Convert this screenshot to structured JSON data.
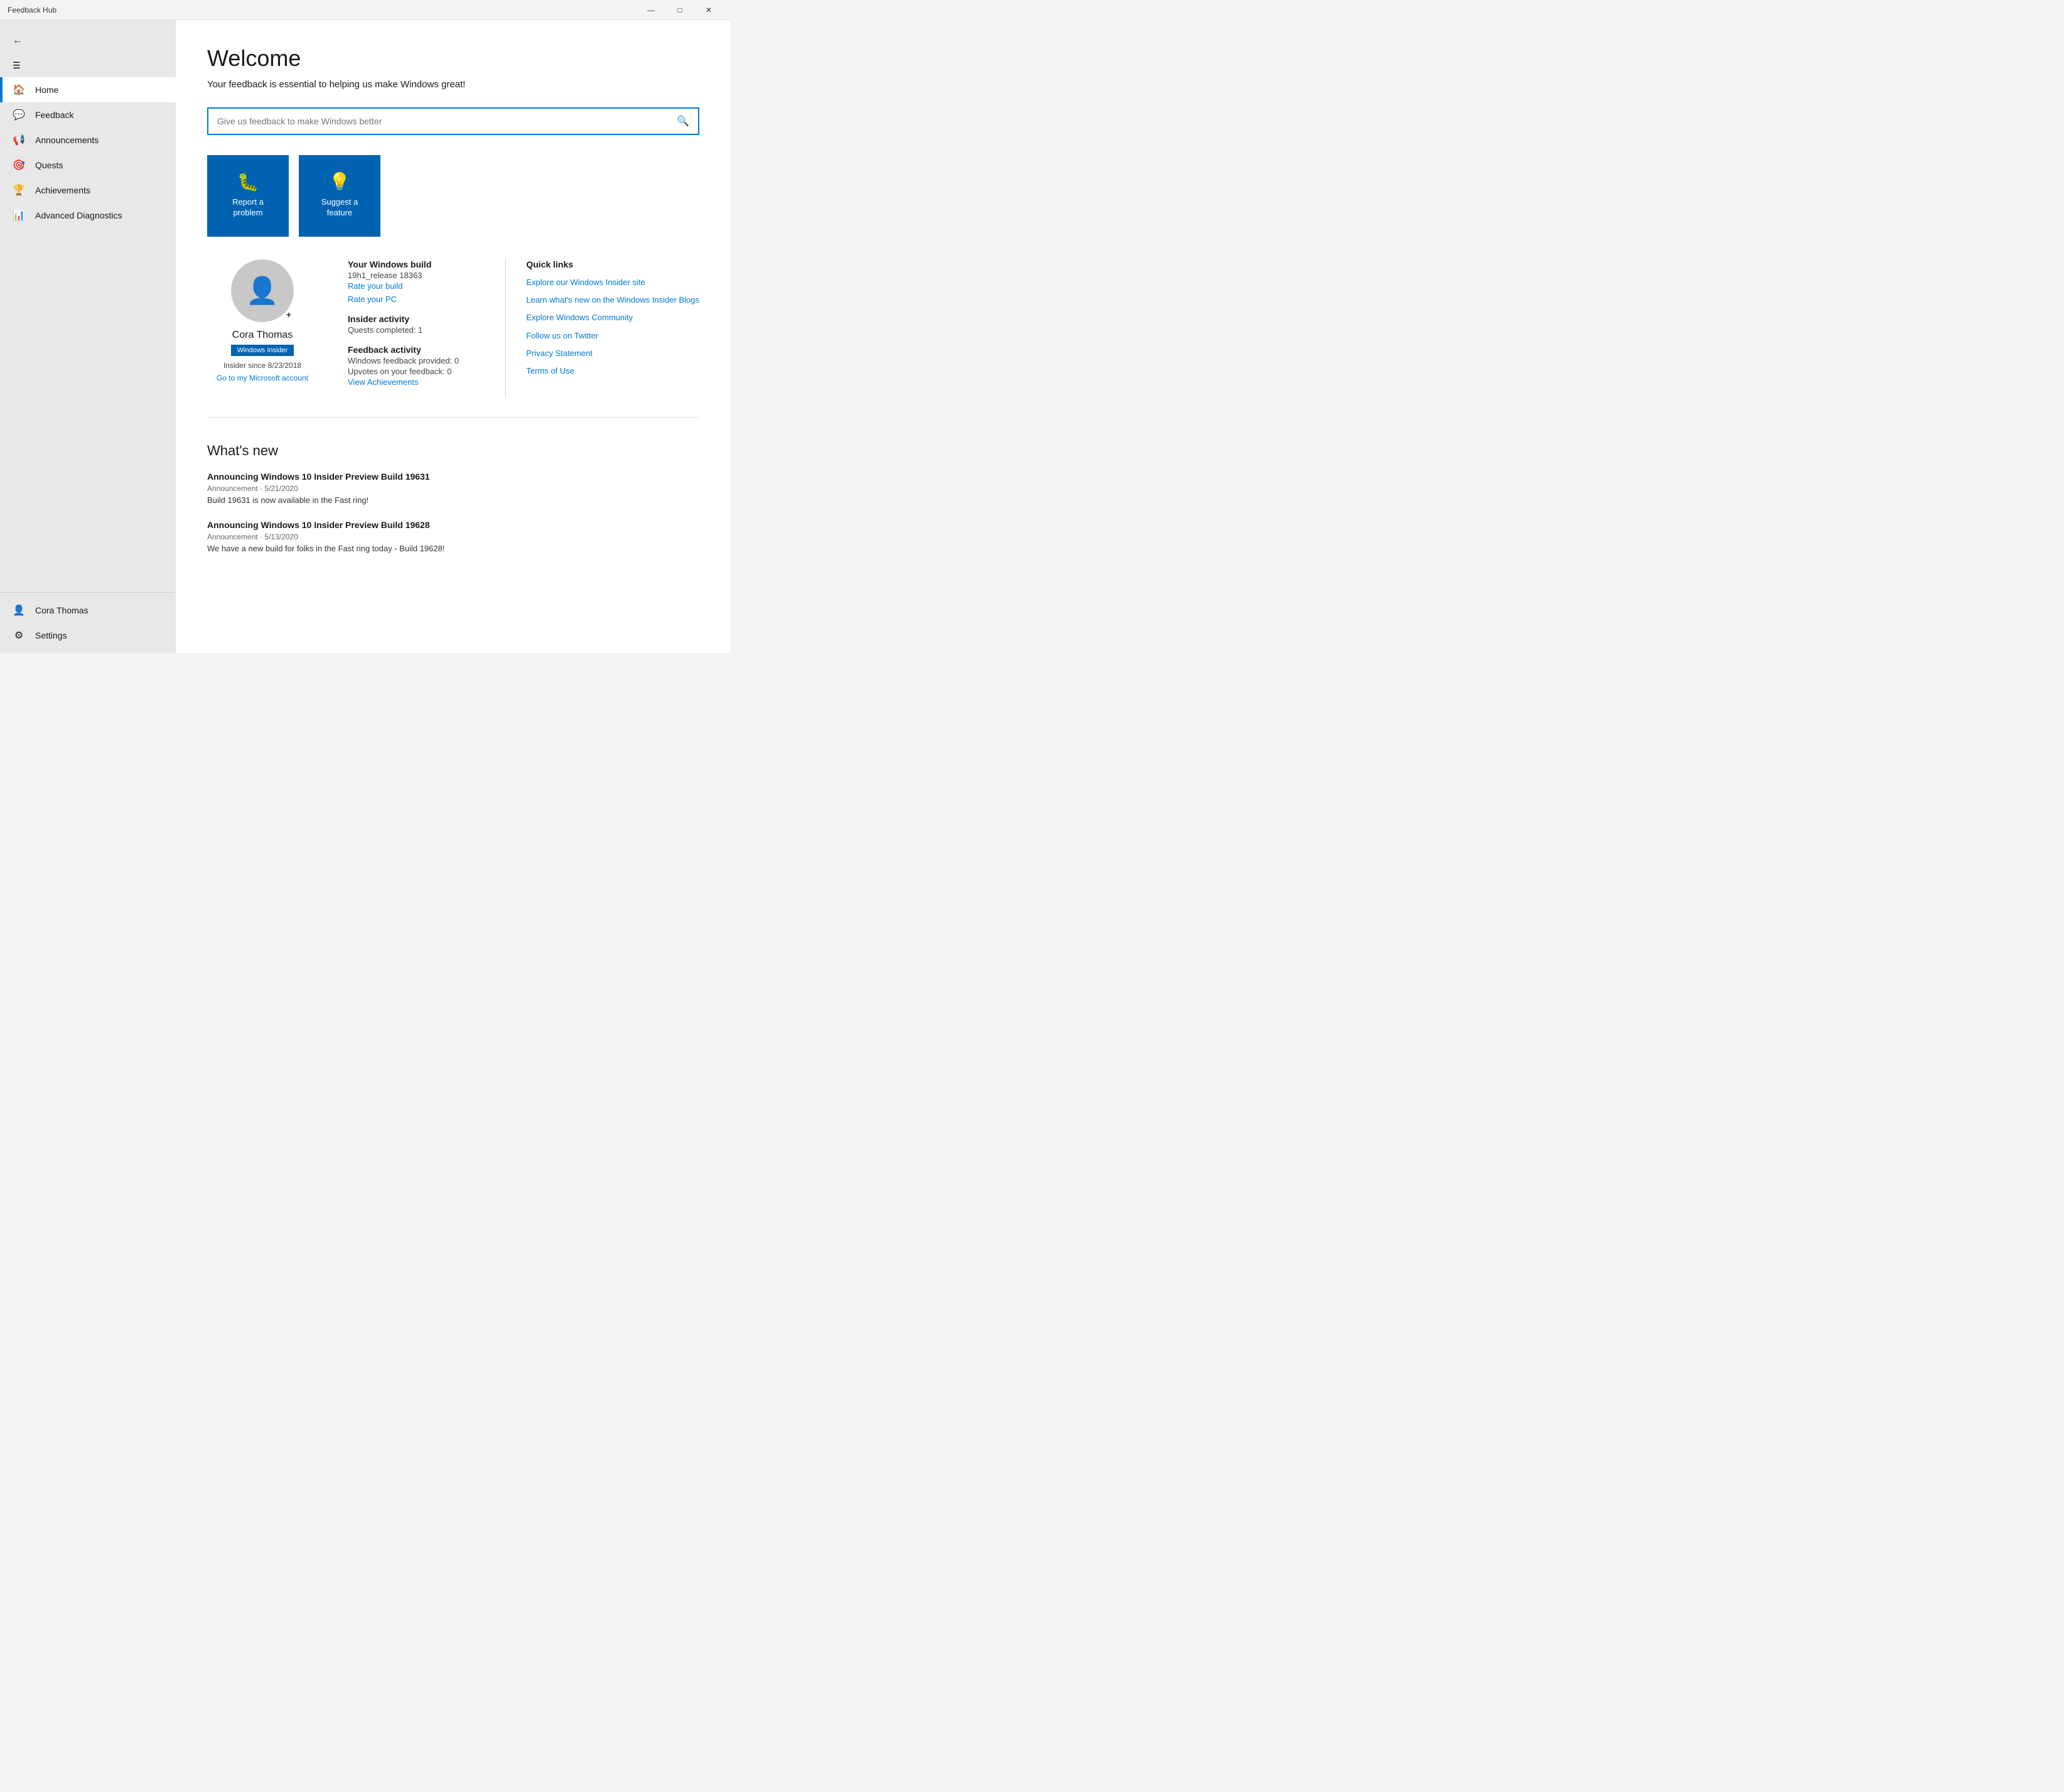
{
  "titleBar": {
    "title": "Feedback Hub",
    "minimizeLabel": "—",
    "maximizeLabel": "□",
    "closeLabel": "✕"
  },
  "sidebar": {
    "hamburgerAriaLabel": "Menu",
    "backAriaLabel": "Back",
    "navItems": [
      {
        "id": "home",
        "label": "Home",
        "icon": "🏠",
        "active": true
      },
      {
        "id": "feedback",
        "label": "Feedback",
        "icon": "💬",
        "active": false
      },
      {
        "id": "announcements",
        "label": "Announcements",
        "icon": "📢",
        "active": false
      },
      {
        "id": "quests",
        "label": "Quests",
        "icon": "🎯",
        "active": false
      },
      {
        "id": "achievements",
        "label": "Achievements",
        "icon": "🏆",
        "active": false
      },
      {
        "id": "advanced-diagnostics",
        "label": "Advanced Diagnostics",
        "icon": "📊",
        "active": false
      }
    ],
    "bottomItems": [
      {
        "id": "user",
        "label": "Cora Thomas",
        "icon": "👤"
      },
      {
        "id": "settings",
        "label": "Settings",
        "icon": "⚙"
      }
    ]
  },
  "main": {
    "welcomeTitle": "Welcome",
    "welcomeSubtitle": "Your feedback is essential to helping us make Windows great!",
    "searchPlaceholder": "Give us feedback to make Windows better",
    "searchIconLabel": "🔍",
    "actionCards": [
      {
        "id": "report-problem",
        "label": "Report a problem",
        "icon": "🐛"
      },
      {
        "id": "suggest-feature",
        "label": "Suggest a feature",
        "icon": "💡"
      }
    ],
    "userProfile": {
      "name": "Cora Thomas",
      "badge": "Windows Insider",
      "insiderSince": "Insider since 8/23/2018",
      "accountLink": "Go to my Microsoft account"
    },
    "windowsBuild": {
      "title": "Your Windows build",
      "value": "19h1_release 18363",
      "rateBuildLink": "Rate your build",
      "ratePCLink": "Rate your PC"
    },
    "insiderActivity": {
      "title": "Insider activity",
      "questsCompleted": "Quests completed: 1"
    },
    "feedbackActivity": {
      "title": "Feedback activity",
      "provided": "Windows feedback provided: 0",
      "upvotes": "Upvotes on your feedback: 0",
      "viewAchievementsLink": "View Achievements"
    },
    "quickLinks": {
      "title": "Quick links",
      "links": [
        {
          "id": "explore-insider",
          "text": "Explore our Windows Insider site"
        },
        {
          "id": "learn-blogs",
          "text": "Learn what's new on the Windows Insider Blogs"
        },
        {
          "id": "explore-community",
          "text": "Explore Windows Community"
        },
        {
          "id": "follow-twitter",
          "text": "Follow us on Twitter"
        },
        {
          "id": "privacy-statement",
          "text": "Privacy Statement"
        },
        {
          "id": "terms-of-use",
          "text": "Terms of Use"
        }
      ]
    },
    "whatsNew": {
      "title": "What's new",
      "items": [
        {
          "id": "build-19631",
          "title": "Announcing Windows 10 Insider Preview Build 19631",
          "meta": "Announcement · 5/21/2020",
          "description": "Build 19631 is now available in the Fast ring!"
        },
        {
          "id": "build-19628",
          "title": "Announcing Windows 10 Insider Preview Build 19628",
          "meta": "Announcement · 5/13/2020",
          "description": "We have a new build for folks in the Fast ring today - Build 19628!"
        }
      ]
    }
  }
}
